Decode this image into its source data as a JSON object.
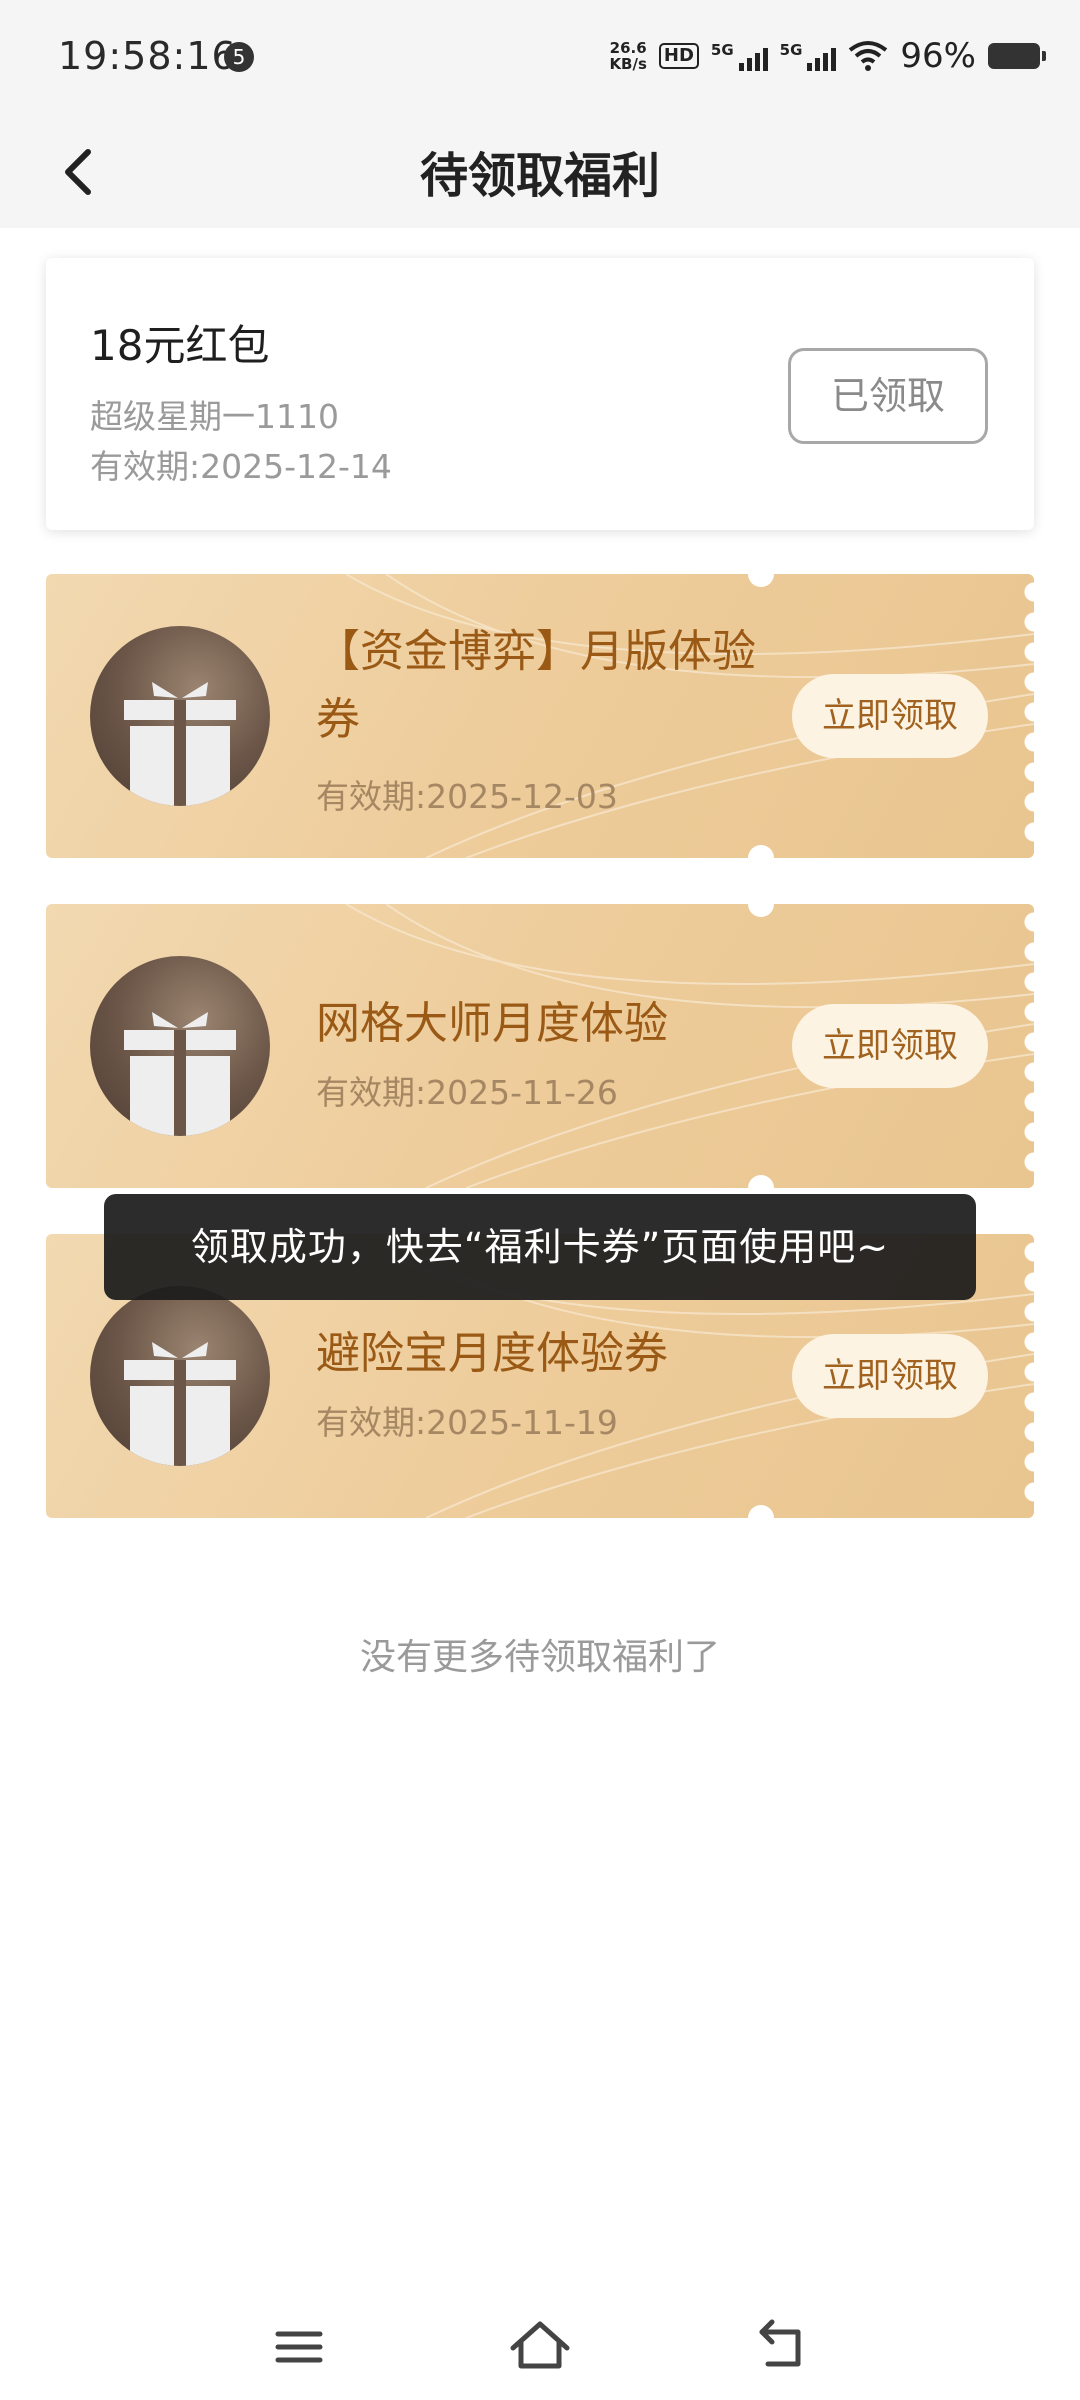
{
  "status_bar": {
    "time": "19:58:16",
    "notification_count": "5",
    "net_speed": "26.6",
    "net_speed_unit": "KB/s",
    "hd_label": "HD",
    "signal1_label": "5G",
    "signal2_label": "5G",
    "battery": "96%"
  },
  "header": {
    "title": "待领取福利",
    "back_icon": "chevron-left-icon"
  },
  "received_card": {
    "title": "18元红包",
    "subtitle": "超级星期一1110",
    "expiry": "有效期:2025-12-14",
    "button": "已领取"
  },
  "tickets": [
    {
      "title": "【资金博弈】月版体验券",
      "expiry": "有效期:2025-12-03",
      "button": "立即领取",
      "icon": "gift-icon"
    },
    {
      "title": "网格大师月度体验",
      "expiry": "有效期:2025-11-26",
      "button": "立即领取",
      "icon": "gift-icon"
    },
    {
      "title": "避险宝月度体验券",
      "expiry": "有效期:2025-11-19",
      "button": "立即领取",
      "icon": "gift-icon"
    }
  ],
  "toast": "领取成功，快去“福利卡券”页面使用吧~",
  "footer_note": "没有更多待领取福利了",
  "nav_bar": {
    "menu_icon": "menu-icon",
    "home_icon": "home-icon",
    "back_icon": "back-icon"
  },
  "colors": {
    "ticket_gold": "#eecd9c",
    "ticket_text": "#9a5a16",
    "button_bg": "#fdf3e2"
  }
}
